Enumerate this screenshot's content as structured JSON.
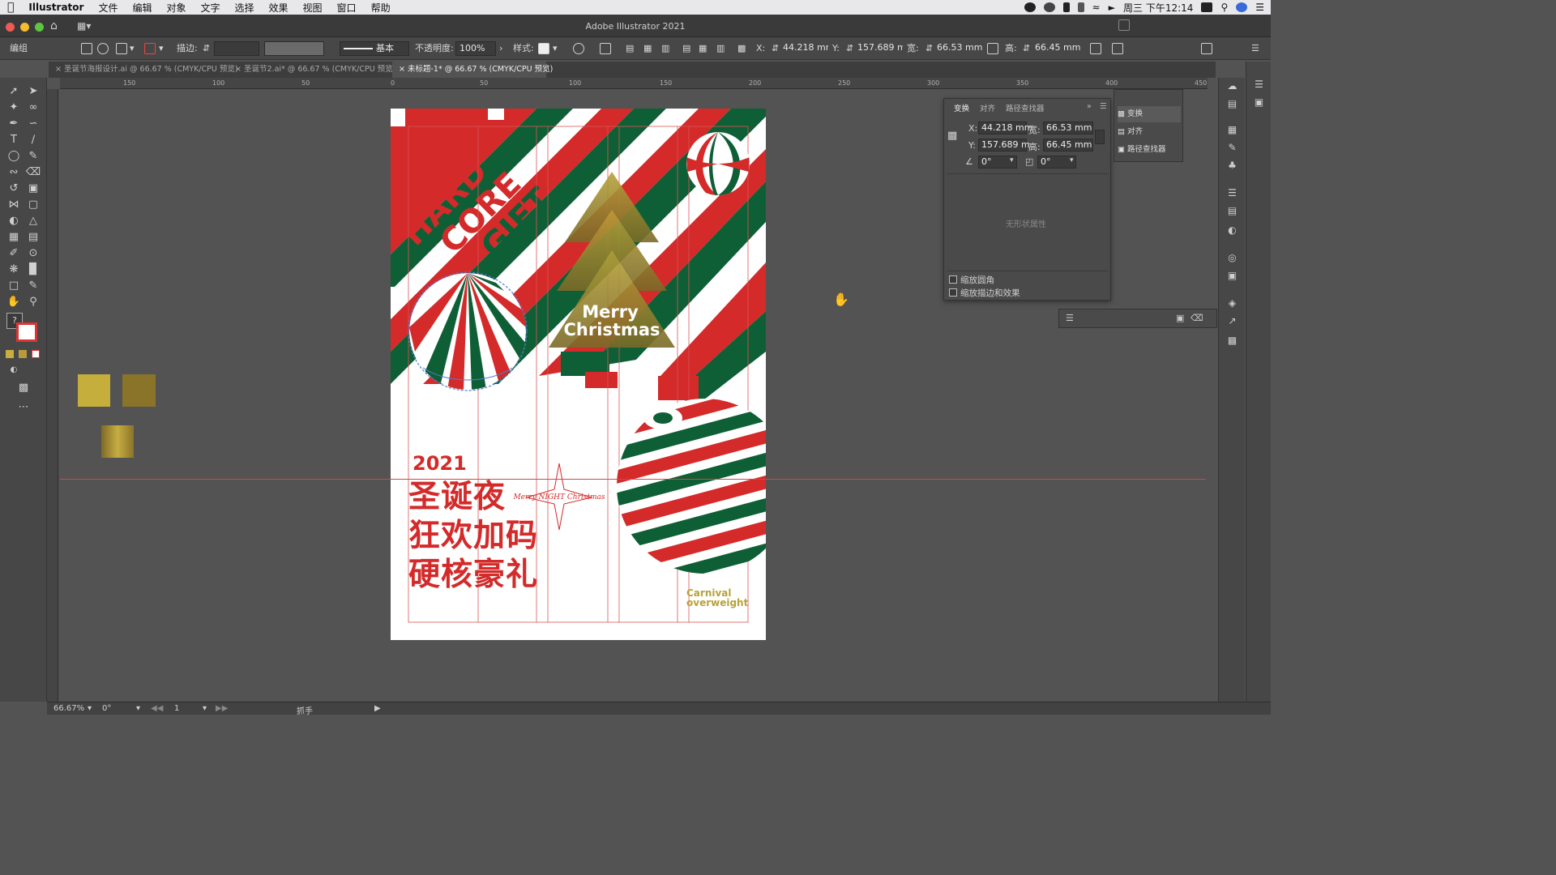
{
  "menubar": {
    "app": "Illustrator",
    "items": [
      "文件",
      "编辑",
      "对象",
      "文字",
      "选择",
      "效果",
      "视图",
      "窗口",
      "帮助"
    ],
    "clock": "周三 下午12:14"
  },
  "window": {
    "title": "Adobe Illustrator 2021"
  },
  "controlbar": {
    "mode": "编组",
    "stroke_label": "描边:",
    "stroke_style": "基本",
    "opacity_label": "不透明度:",
    "opacity": "100%",
    "style_label": "样式:",
    "x_label": "X:",
    "x": "44.218 mm",
    "y_label": "Y:",
    "y": "157.689 m",
    "w_label": "宽:",
    "w": "66.53 mm",
    "h_label": "高:",
    "h": "66.45 mm"
  },
  "tabs": [
    {
      "label": "圣诞节海报设计.ai @ 66.67 % (CMYK/CPU 预览)"
    },
    {
      "label": "圣诞节2.ai* @ 66.67 % (CMYK/CPU 预览)"
    },
    {
      "label": "未标题-1* @ 66.67 % (CMYK/CPU 预览)"
    }
  ],
  "ruler": {
    "h_ticks": [
      "150",
      "100",
      "50",
      "0",
      "50",
      "100",
      "150",
      "200",
      "250",
      "300",
      "350",
      "400",
      "450"
    ]
  },
  "transform_panel": {
    "tabs": [
      "变换",
      "对齐",
      "路径查找器"
    ],
    "x_label": "X:",
    "x": "44.218 mm",
    "w_label": "宽:",
    "w": "66.53 mm",
    "y_label": "Y:",
    "y": "157.689 m",
    "h_label": "高:",
    "h": "66.45 mm",
    "angle": "0°",
    "shear": "0°",
    "no_shape": "无形状属性",
    "scale_corners": "缩放圆角",
    "scale_strokes": "缩放描边和效果"
  },
  "collapsed_panel": {
    "items": [
      "变换",
      "对齐",
      "路径查找器"
    ]
  },
  "artwork": {
    "hardcore": [
      "HARD",
      "CORE",
      "GIFT"
    ],
    "merry": "Merry",
    "christmas": "Christmas",
    "year": "2021",
    "line1": "圣诞夜",
    "line2": "狂欢加码",
    "line3": "硬核豪礼",
    "carnival1": "Carnival",
    "carnival2": "overweight",
    "script": "Merry NIGHT Christmas",
    "colors": {
      "red": "#d42a2a",
      "green": "#0f5f36",
      "gold": "#b8a23a",
      "dark_gold": "#7a6a28"
    }
  },
  "status": {
    "zoom": "66.67%",
    "rotate": "0°",
    "artboard": "1",
    "tool": "抓手"
  }
}
